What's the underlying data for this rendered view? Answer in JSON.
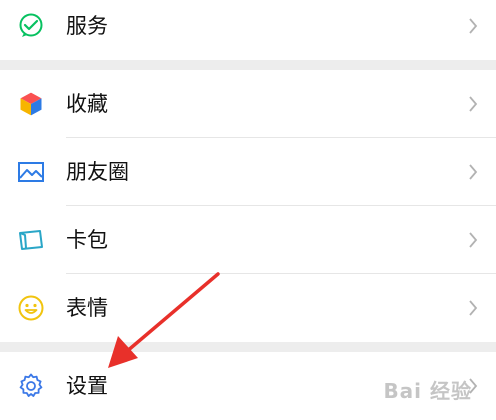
{
  "items": {
    "services": {
      "label": "服务",
      "icon": "wechat-pay-icon",
      "color": "#07c160"
    },
    "favorites": {
      "label": "收藏",
      "icon": "cube-icon"
    },
    "moments": {
      "label": "朋友圈",
      "icon": "photo-icon",
      "color": "#2d7be5"
    },
    "card_pack": {
      "label": "卡包",
      "icon": "card-icon",
      "color": "#2aa6c7"
    },
    "stickers": {
      "label": "表情",
      "icon": "smiley-icon",
      "color": "#f1c40f"
    },
    "settings": {
      "label": "设置",
      "icon": "gear-icon",
      "color": "#3b78e7"
    }
  },
  "watermark": "Bai 经验",
  "colors": {
    "background": "#ededed",
    "arrow": "#e8302a",
    "chevron": "#b2b2b2"
  }
}
